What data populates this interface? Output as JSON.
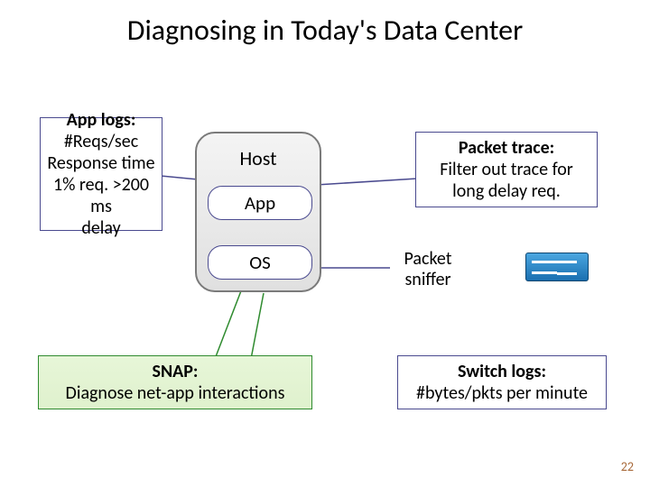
{
  "title": "Diagnosing in Today's Data Center",
  "app_logs": {
    "heading": "App logs:",
    "l1": "#Reqs/sec",
    "l2": "Response time",
    "l3": "1% req. >200 ms",
    "l4": "delay"
  },
  "host": {
    "label": "Host",
    "app": "App",
    "os": "OS"
  },
  "packet_trace": {
    "heading": "Packet trace:",
    "l1": "Filter out trace for",
    "l2": "long delay req."
  },
  "sniffer_label_l1": "Packet",
  "sniffer_label_l2": "sniffer",
  "snap": {
    "heading": "SNAP:",
    "l1": "Diagnose net-app interactions"
  },
  "switch_logs": {
    "heading": "Switch logs:",
    "l1": "#bytes/pkts per minute"
  },
  "page_number": "22"
}
